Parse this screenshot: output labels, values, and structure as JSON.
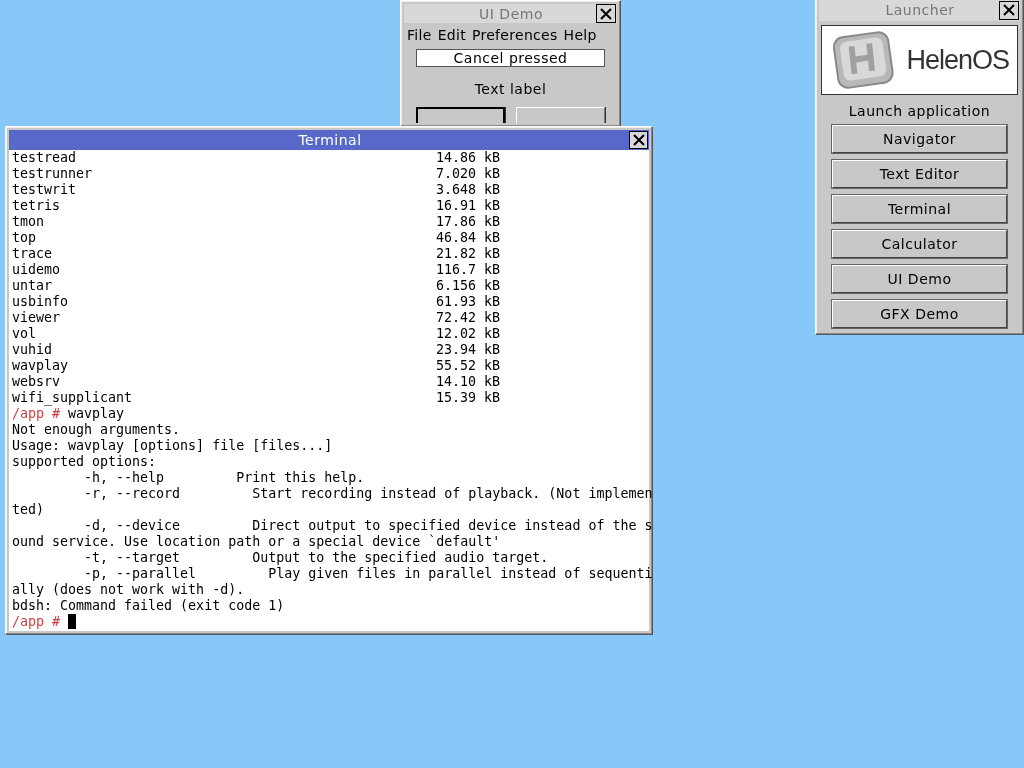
{
  "ui_demo": {
    "title": "UI Demo",
    "active": false,
    "menu": [
      "File",
      "Edit",
      "Preferences",
      "Help"
    ],
    "entry": {
      "value": "Cancel pressed"
    },
    "label": "Text label",
    "buttons": [
      {
        "default": true
      },
      {
        "default": false
      }
    ]
  },
  "launcher": {
    "title": "Launcher",
    "active": false,
    "logo_text": "HelenOS",
    "heading": "Launch application",
    "buttons": [
      "Navigator",
      "Text Editor",
      "Terminal",
      "Calculator",
      "UI Demo",
      "GFX Demo"
    ]
  },
  "terminal": {
    "title": "Terminal",
    "active": true,
    "lines": [
      {
        "kind": "file",
        "name": "testread",
        "size": "14.86 kB"
      },
      {
        "kind": "file",
        "name": "testrunner",
        "size": "7.020 kB"
      },
      {
        "kind": "file",
        "name": "testwrit",
        "size": "3.648 kB"
      },
      {
        "kind": "file",
        "name": "tetris",
        "size": "16.91 kB"
      },
      {
        "kind": "file",
        "name": "tmon",
        "size": "17.86 kB"
      },
      {
        "kind": "file",
        "name": "top",
        "size": "46.84 kB"
      },
      {
        "kind": "file",
        "name": "trace",
        "size": "21.82 kB"
      },
      {
        "kind": "file",
        "name": "uidemo",
        "size": "116.7 kB"
      },
      {
        "kind": "file",
        "name": "untar",
        "size": "6.156 kB"
      },
      {
        "kind": "file",
        "name": "usbinfo",
        "size": "61.93 kB"
      },
      {
        "kind": "file",
        "name": "viewer",
        "size": "72.42 kB"
      },
      {
        "kind": "file",
        "name": "vol",
        "size": "12.02 kB"
      },
      {
        "kind": "file",
        "name": "vuhid",
        "size": "23.94 kB"
      },
      {
        "kind": "file",
        "name": "wavplay",
        "size": "55.52 kB"
      },
      {
        "kind": "file",
        "name": "websrv",
        "size": "14.10 kB"
      },
      {
        "kind": "file",
        "name": "wifi_supplicant",
        "size": "15.39 kB"
      },
      {
        "kind": "prompt",
        "prompt": "/app #",
        "command": "wavplay",
        "cursor": false
      },
      {
        "kind": "output",
        "text": "Not enough arguments."
      },
      {
        "kind": "output",
        "text": "Usage: wavplay [options] file [files...]"
      },
      {
        "kind": "output",
        "text": "supported options:"
      },
      {
        "kind": "output",
        "text": "         -h, --help         Print this help."
      },
      {
        "kind": "output",
        "text": "         -r, --record         Start recording instead of playback. (Not implemen"
      },
      {
        "kind": "output",
        "text": "ted)"
      },
      {
        "kind": "output",
        "text": "         -d, --device         Direct output to specified device instead of the s"
      },
      {
        "kind": "output",
        "text": "ound service. Use location path or a special device `default'"
      },
      {
        "kind": "output",
        "text": "         -t, --target         Output to the specified audio target."
      },
      {
        "kind": "output",
        "text": "         -p, --parallel         Play given files in parallel instead of sequenti"
      },
      {
        "kind": "output",
        "text": "ally (does not work with -d)."
      },
      {
        "kind": "output",
        "text": "bdsh: Command failed (exit code 1)"
      },
      {
        "kind": "prompt",
        "prompt": "/app #",
        "cursor": true
      }
    ]
  }
}
